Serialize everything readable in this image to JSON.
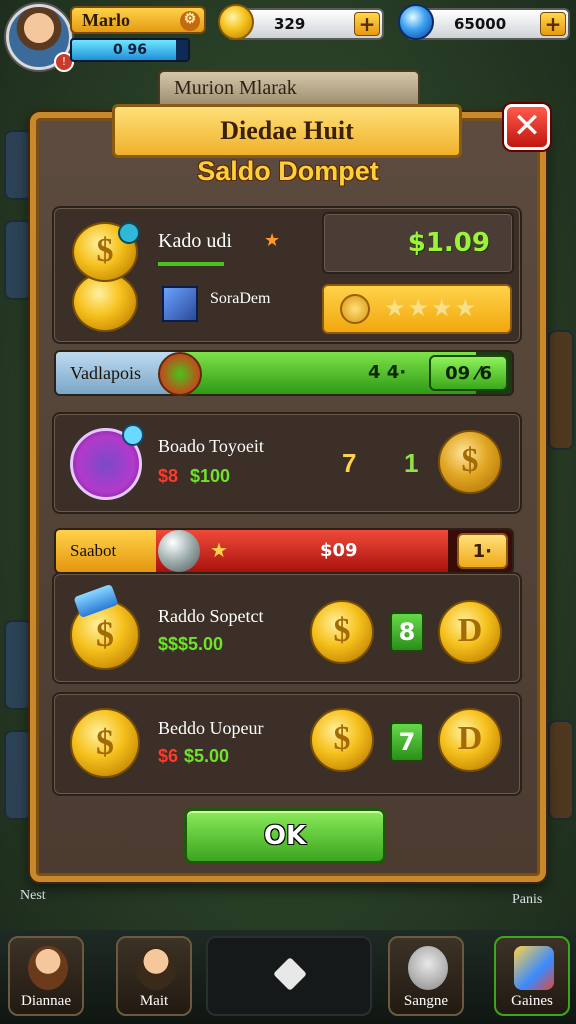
{
  "player": {
    "name": "Marlo",
    "xp_text": "0 96",
    "xp_progress": 0.9
  },
  "currencies": [
    {
      "icon": "gold-coin-icon",
      "amount": "329"
    },
    {
      "icon": "blue-gem-icon",
      "amount": "65000"
    }
  ],
  "background_plate": "Murion Mlarak",
  "side_labels": {
    "left_bottom": "Nest",
    "right_bottom": "Panis"
  },
  "dialog": {
    "title": "Diedae Huit",
    "heading": "Saldo Dompet",
    "close_label": "✕",
    "top_card": {
      "title": "Kado udi",
      "subtitle": "SoraDem",
      "balance": "$1.09",
      "stars": "★★★★"
    },
    "progress_green": {
      "label": "Vadlapois",
      "value": "4 4·",
      "end": "09 ⁄6",
      "fill": 0.92
    },
    "row_1": {
      "title": "Boado Toyoeit",
      "price_red": "$8",
      "price_green": "$100",
      "num_a": "7",
      "num_b": "1"
    },
    "progress_red": {
      "label": "Saabot",
      "value": "$09",
      "end": "1·",
      "fill": 0.86
    },
    "row_2": {
      "title": "Raddo Sopetct",
      "price": "$$$5.00",
      "num": "8"
    },
    "row_3": {
      "title": "Beddo Uopeur",
      "price_red": "$6",
      "price_green": "$5.00",
      "num": "7"
    },
    "ok_label": "OK"
  },
  "nav": [
    {
      "label": "Diannae",
      "icon": "hero-portrait-icon"
    },
    {
      "label": "Mait",
      "icon": "character-icon"
    },
    {
      "label": "",
      "icon": "diamond-icon"
    },
    {
      "label": "Sangne",
      "icon": "helmet-icon"
    },
    {
      "label": "Gaines",
      "icon": "games-icon"
    }
  ],
  "colors": {
    "gold": "#f0b12a",
    "green": "#3ba51e",
    "red": "#c1160f",
    "panel": "#4b3b30"
  }
}
